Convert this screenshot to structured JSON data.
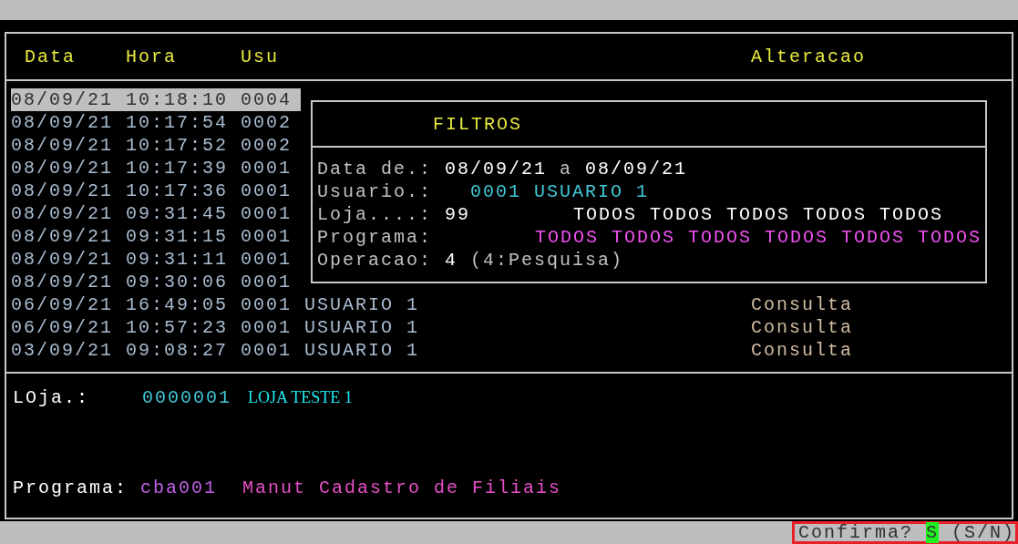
{
  "header": {
    "columns": [
      {
        "label": "Data"
      },
      {
        "label": "Hora"
      },
      {
        "label": "Usu"
      },
      {
        "label": "Alteracao"
      }
    ]
  },
  "rows": [
    {
      "date": "08/09/21",
      "time": "10:18:10",
      "user": "0004",
      "selected": true
    },
    {
      "date": "08/09/21",
      "time": "10:17:54",
      "user": "0002",
      "selected": false
    },
    {
      "date": "08/09/21",
      "time": "10:17:52",
      "user": "0002",
      "selected": false
    },
    {
      "date": "08/09/21",
      "time": "10:17:39",
      "user": "0001",
      "selected": false
    },
    {
      "date": "08/09/21",
      "time": "10:17:36",
      "user": "0001",
      "selected": false
    },
    {
      "date": "08/09/21",
      "time": "09:31:45",
      "user": "0001",
      "selected": false
    },
    {
      "date": "08/09/21",
      "time": "09:31:15",
      "user": "0001",
      "selected": false
    },
    {
      "date": "08/09/21",
      "time": "09:31:11",
      "user": "0001",
      "selected": false
    },
    {
      "date": "08/09/21",
      "time": "09:30:06",
      "user": "0001",
      "selected": false
    },
    {
      "date": "06/09/21",
      "time": "16:49:05",
      "user": "0001",
      "user_name": "USUARIO 1",
      "change": "Consulta",
      "selected": false
    },
    {
      "date": "06/09/21",
      "time": "10:57:23",
      "user": "0001",
      "user_name": "USUARIO 1",
      "change": "Consulta",
      "selected": false
    },
    {
      "date": "03/09/21",
      "time": "09:08:27",
      "user": "0001",
      "user_name": "USUARIO 1",
      "change": "Consulta",
      "selected": false
    }
  ],
  "filters": {
    "title": "FILTROS",
    "fields": [
      {
        "label": "Data de.:",
        "values": [
          {
            "text": "08/09/21",
            "color": "#ffffff"
          },
          {
            "text": "a",
            "color": "#c0c0c0"
          },
          {
            "text": "08/09/21",
            "color": "#ffffff"
          }
        ]
      },
      {
        "label": "Usuario.:",
        "values": [
          {
            "text": "0001",
            "color": "#40c8d8"
          },
          {
            "text": "USUARIO 1",
            "color": "#40c8d8"
          }
        ]
      },
      {
        "label": "Loja....:",
        "values": [
          {
            "text": "99",
            "color": "#ffffff"
          }
        ],
        "options": {
          "color": "#ffffff",
          "items": [
            "TODOS",
            "TODOS",
            "TODOS",
            "TODOS",
            "TODOS"
          ]
        }
      },
      {
        "label": "Programa:",
        "options": {
          "color": "#f050f0",
          "items": [
            "TODOS",
            "TODOS",
            "TODOS",
            "TODOS",
            "TODOS",
            "TODOS"
          ]
        }
      },
      {
        "label": "Operacao:",
        "values": [
          {
            "text": "4",
            "color": "#ffffff"
          },
          {
            "text": "(4:Pesquisa)",
            "color": "#c0c0c0"
          }
        ]
      }
    ]
  },
  "details": {
    "store_label": "LOja.:",
    "store_code": "0000001",
    "store_name": "LOJA TESTE 1",
    "program_label": "Programa:",
    "program_code": "cba001",
    "program_name": "Manut Cadastro de Filiais"
  },
  "status": {
    "prompt": "Confirma?",
    "answer": "S",
    "choices": "(S/N)"
  }
}
